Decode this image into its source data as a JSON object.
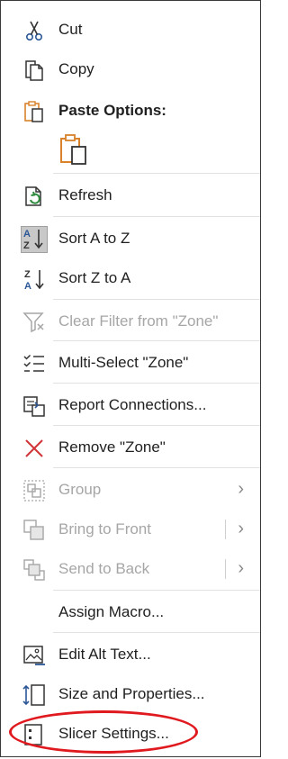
{
  "menu": {
    "cut": {
      "label": "Cut",
      "icon": "scissors-icon"
    },
    "copy": {
      "label": "Copy",
      "icon": "copy-icon"
    },
    "paste_options": {
      "label": "Paste Options:",
      "icon": "paste-icon",
      "button_icon": "paste-clipboard-icon"
    },
    "refresh": {
      "label": "Refresh",
      "icon": "refresh-icon"
    },
    "sort_az": {
      "label": "Sort A to Z",
      "icon": "sort-a-to-z-icon"
    },
    "sort_za": {
      "label": "Sort Z to A",
      "icon": "sort-z-to-a-icon"
    },
    "clear_filter": {
      "label": "Clear Filter from \"Zone\"",
      "icon": "clear-filter-icon",
      "disabled": true
    },
    "multi_select": {
      "label": "Multi-Select \"Zone\"",
      "icon": "multi-select-icon"
    },
    "report_connections": {
      "label": "Report Connections...",
      "icon": "report-connections-icon"
    },
    "remove": {
      "label": "Remove \"Zone\"",
      "icon": "remove-x-icon"
    },
    "group": {
      "label": "Group",
      "icon": "group-icon",
      "disabled": true
    },
    "bring_to_front": {
      "label": "Bring to Front",
      "icon": "bring-to-front-icon",
      "disabled": true
    },
    "send_to_back": {
      "label": "Send to Back",
      "icon": "send-to-back-icon",
      "disabled": true
    },
    "assign_macro": {
      "label": "Assign Macro..."
    },
    "edit_alt_text": {
      "label": "Edit Alt Text...",
      "icon": "alt-text-icon"
    },
    "size_properties": {
      "label": "Size and Properties...",
      "icon": "size-properties-icon"
    },
    "slicer_settings": {
      "label": "Slicer Settings...",
      "icon": "slicer-settings-icon"
    }
  },
  "colors": {
    "accent_orange": "#d9822b",
    "remove_red": "#d13438",
    "highlight_red": "#e0191e",
    "disabled_gray": "#a6a6a6"
  }
}
